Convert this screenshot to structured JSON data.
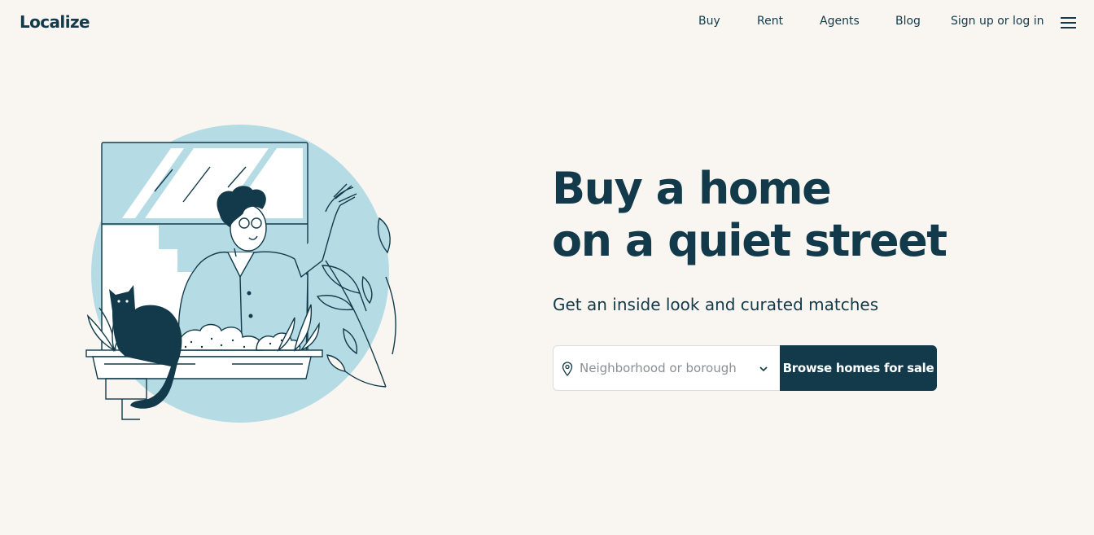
{
  "brand": {
    "name": "Localize"
  },
  "nav": {
    "items": [
      {
        "label": "Buy"
      },
      {
        "label": "Rent"
      },
      {
        "label": "Agents"
      },
      {
        "label": "Blog"
      },
      {
        "label": "Sign up or log in"
      }
    ],
    "menu_icon": "hamburger-menu-icon"
  },
  "hero": {
    "headline_line1": "Buy a home",
    "headline_line2": "on a quiet street",
    "subheadline": "Get an inside look and curated matches",
    "search": {
      "placeholder": "Neighborhood or borough",
      "value": "",
      "leading_icon": "map-pin-icon",
      "trailing_icon": "chevron-down-icon"
    },
    "cta_label": "Browse homes for sale",
    "illustration": "person-waving-from-window-with-cat-illustration"
  },
  "colors": {
    "background": "#f9f6f2",
    "primary": "#123a4a",
    "accent_light_blue": "#b5dce4",
    "white": "#ffffff"
  }
}
